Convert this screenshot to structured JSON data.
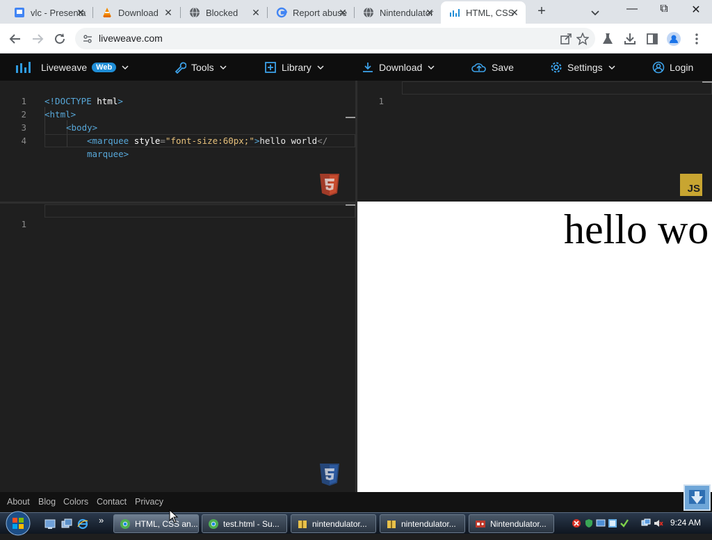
{
  "browser": {
    "tabs": [
      {
        "title": "vlc - Presentation",
        "icon": "presentation-icon",
        "active": false
      },
      {
        "title": "Download",
        "icon": "vlc-icon",
        "active": false
      },
      {
        "title": "Blocked",
        "icon": "globe-icon",
        "active": false
      },
      {
        "title": "Report abuse",
        "icon": "google-icon",
        "active": false
      },
      {
        "title": "Nintendulator",
        "icon": "globe-icon",
        "active": false
      },
      {
        "title": "HTML, CSS",
        "icon": "liveweave-icon",
        "active": true
      }
    ],
    "tab_close_glyph": "✕",
    "new_tab_glyph": "+",
    "window_controls": {
      "minimize": "—",
      "restore": "⧉",
      "close": "✕"
    },
    "address": "liveweave.com"
  },
  "liveweave": {
    "brand": "Liveweave",
    "badge": "Web",
    "menu": {
      "tools": "Tools",
      "library": "Library",
      "download": "Download",
      "save": "Save",
      "settings": "Settings",
      "login": "Login"
    },
    "html_editor": {
      "line_numbers": [
        "1",
        "2",
        "3",
        "4",
        ""
      ],
      "lines": [
        {
          "parts": [
            "<!DOCTYPE",
            " html",
            ">"
          ]
        },
        {
          "parts": [
            "<html>"
          ]
        },
        {
          "parts": [
            "<body>"
          ]
        },
        {
          "parts": [
            "<marquee",
            " style",
            "=",
            "\"font-size:60px;\"",
            ">",
            "hello world",
            "</"
          ]
        },
        {
          "parts": [
            "marquee>"
          ]
        }
      ]
    },
    "js_editor": {
      "line_numbers": [
        "1"
      ],
      "badge": "JS"
    },
    "css_editor": {
      "line_numbers": [
        "1"
      ]
    },
    "preview_text": "hello wo",
    "footer_links": [
      "About",
      "Blog",
      "Colors",
      "Contact",
      "Privacy"
    ]
  },
  "taskbar": {
    "quicklaunch_more": "»",
    "tasks": [
      {
        "label": "HTML, CSS an...",
        "active": true
      },
      {
        "label": "test.html - Su...",
        "active": false
      },
      {
        "label": "nintendulator...",
        "active": false
      },
      {
        "label": "nintendulator...",
        "active": false
      },
      {
        "label": "Nintendulator...",
        "active": false
      }
    ],
    "clock": "9:24 AM"
  },
  "colors": {
    "editor_bg": "#1f1f1f",
    "nav_bg": "#0e0e0e",
    "accent": "#1f8dd6",
    "tag": "#57a7d8",
    "string": "#e6c07b",
    "html5_badge": "#e44d26",
    "css3_badge": "#2965f1",
    "js_badge": "#c8a531"
  }
}
